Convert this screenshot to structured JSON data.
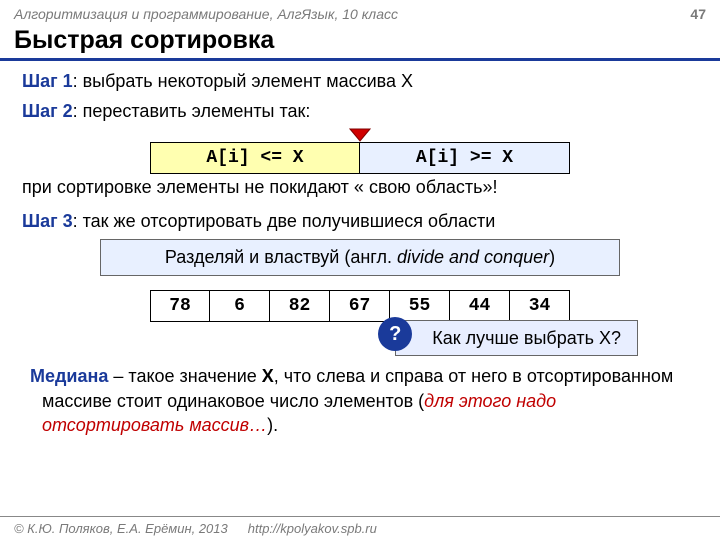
{
  "header": {
    "course": "Алгоритмизация и программирование, АлгЯзык, 10 класс",
    "page": "47"
  },
  "title": "Быстрая сортировка",
  "steps": {
    "s1_label": "Шаг 1",
    "s1_text": ": выбрать некоторый элемент массива X",
    "s2_label": "Шаг 2",
    "s2_text": ": переставить элементы так:",
    "partition_left": "A[i] <= X",
    "partition_right": "A[i] >= X",
    "s2_note": "при сортировке элементы не покидают « свою область»!",
    "s3_label": "Шаг 3",
    "s3_text": ": так же отсортировать две получившиеся области"
  },
  "divide": {
    "prefix": "Разделяй и властвуй (англ. ",
    "em": "divide and conquer",
    "suffix": ")"
  },
  "array": [
    "78",
    "6",
    "82",
    "67",
    "55",
    "44",
    "34"
  ],
  "question": {
    "badge": "?",
    "text": "Как лучше выбрать X?"
  },
  "median": {
    "label": "Медиана",
    "t1": " – такое значение ",
    "x": "X",
    "t2": ", что слева и справа от него в отсортированном массиве стоит одинаковое число элементов (",
    "em": "для этого надо отсортировать массив…",
    "t3": ")."
  },
  "footer": {
    "copyright": "© К.Ю. Поляков, Е.А. Ерёмин, 2013",
    "url": "http://kpolyakov.spb.ru"
  }
}
